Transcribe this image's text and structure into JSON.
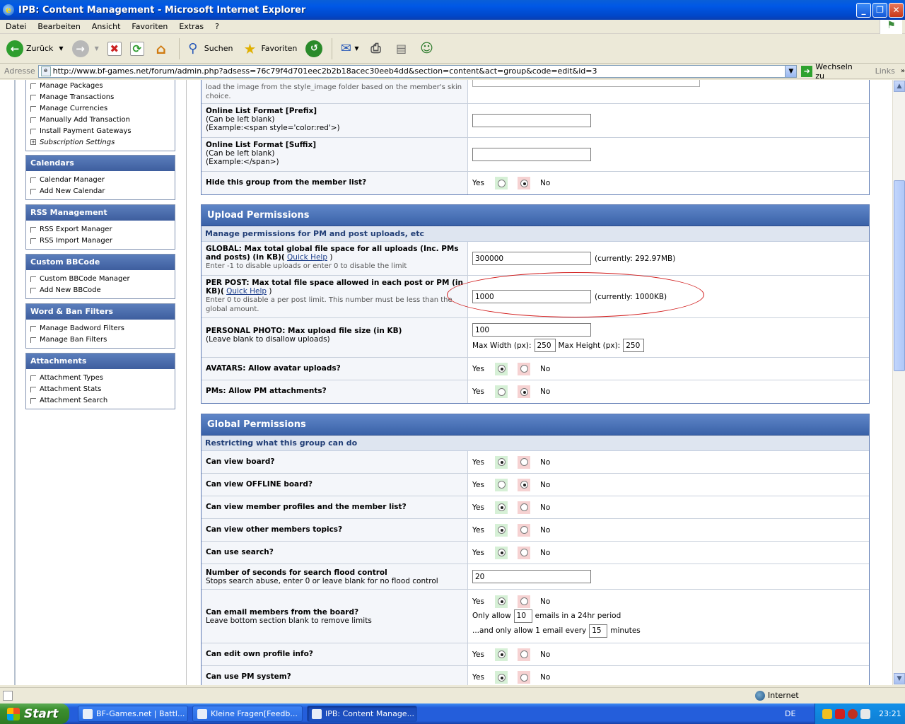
{
  "window": {
    "title": "IPB: Content Management - Microsoft Internet Explorer"
  },
  "menu": [
    "Datei",
    "Bearbeiten",
    "Ansicht",
    "Favoriten",
    "Extras",
    "?"
  ],
  "toolbar": {
    "back": "Zurück",
    "search": "Suchen",
    "favorites": "Favoriten"
  },
  "address": {
    "label": "Adresse",
    "url": "http://www.bf-games.net/forum/admin.php?adsess=76c79f4d701eec2b2b18acec30eeb4dd&section=content&act=group&code=edit&id=3",
    "go": "Wechseln zu",
    "links": "Links"
  },
  "sidebar": {
    "top_items": [
      {
        "label": "Manage Packages"
      },
      {
        "label": "Manage Transactions"
      },
      {
        "label": "Manage Currencies"
      },
      {
        "label": "Manually Add Transaction"
      },
      {
        "label": "Install Payment Gateways"
      },
      {
        "label": "Subscription Settings"
      }
    ],
    "calendars": {
      "title": "Calendars",
      "items": [
        "Calendar Manager",
        "Add New Calendar"
      ]
    },
    "rss": {
      "title": "RSS Management",
      "items": [
        "RSS Export Manager",
        "RSS Import Manager"
      ]
    },
    "bbcode": {
      "title": "Custom BBCode",
      "items": [
        "Custom BBCode Manager",
        "Add New BBCode"
      ]
    },
    "filters": {
      "title": "Word & Ban Filters",
      "items": [
        "Manage Badword Filters",
        "Manage Ban Filters"
      ]
    },
    "attachments": {
      "title": "Attachments",
      "items": [
        "Attachment Types",
        "Attachment Stats",
        "Attachment Search"
      ]
    }
  },
  "top_section": {
    "row0_text": "load the image from the style_image folder based on the member's skin choice.",
    "prefix": {
      "label": "Online List Format [Prefix]",
      "line2": "(Can be left blank)",
      "line3": "(Example:<span style='color:red'>)"
    },
    "suffix": {
      "label": "Online List Format [Suffix]",
      "line2": "(Can be left blank)",
      "line3": "(Example:</span>)"
    },
    "hide": {
      "label": "Hide this group from the member list?"
    }
  },
  "common": {
    "yes": "Yes",
    "no": "No",
    "quick_help": "Quick Help"
  },
  "upload": {
    "title": "Upload Permissions",
    "subtitle": "Manage permissions for PM and post uploads, etc",
    "global": {
      "label": "GLOBAL:",
      "text": " Max total global file space for all uploads (Inc. PMs and posts) (in KB)(",
      "hint": "Enter -1 to disable uploads or enter 0 to disable the limit",
      "value": "300000",
      "current": "(currently: 292.97MB)"
    },
    "perpost": {
      "label": "PER POST:",
      "text": " Max total file space allowed in each post or PM (in KB)(",
      "hint": "Enter 0 to disable a per post limit. This number must be less than the global amount.",
      "value": "1000",
      "current": "(currently: 1000KB)"
    },
    "photo": {
      "label": "PERSONAL PHOTO:",
      "text": " Max upload file size (in KB)",
      "hint": "(Leave blank to disallow uploads)",
      "value": "100",
      "maxw_label": "Max Width (px):",
      "maxw": "250",
      "maxh_label": "Max Height (px):",
      "maxh": "250"
    },
    "avatars": {
      "label": "AVATARS: Allow avatar uploads?"
    },
    "pms": {
      "label": "PMs: Allow PM attachments?"
    }
  },
  "global": {
    "title": "Global Permissions",
    "subtitle": "Restricting what this group can do",
    "view_board": "Can view board?",
    "view_offline": "Can view OFFLINE board?",
    "view_profiles": "Can view member profiles and the member list?",
    "view_topics": "Can view other members topics?",
    "use_search": "Can use search?",
    "flood": {
      "label": "Number of seconds for search flood control",
      "hint": "Stops search abuse, enter 0 or leave blank for no flood control",
      "value": "20"
    },
    "email": {
      "label": "Can email members from the board?",
      "hint": "Leave bottom section blank to remove limits",
      "only_allow": "Only allow",
      "emails_value": "10",
      "period": "emails in a 24hr period",
      "only_every": "...and only allow 1 email every",
      "minutes_value": "15",
      "minutes": "minutes"
    },
    "edit_profile": "Can edit own profile info?",
    "use_pm": "Can use PM system?"
  },
  "status": {
    "zone": "Internet"
  },
  "taskbar": {
    "start": "Start",
    "tasks": [
      "BF-Games.net | Battl...",
      "Kleine Fragen[Feedb...",
      "IPB: Content Manage..."
    ],
    "lang": "DE",
    "clock": "23:21"
  }
}
